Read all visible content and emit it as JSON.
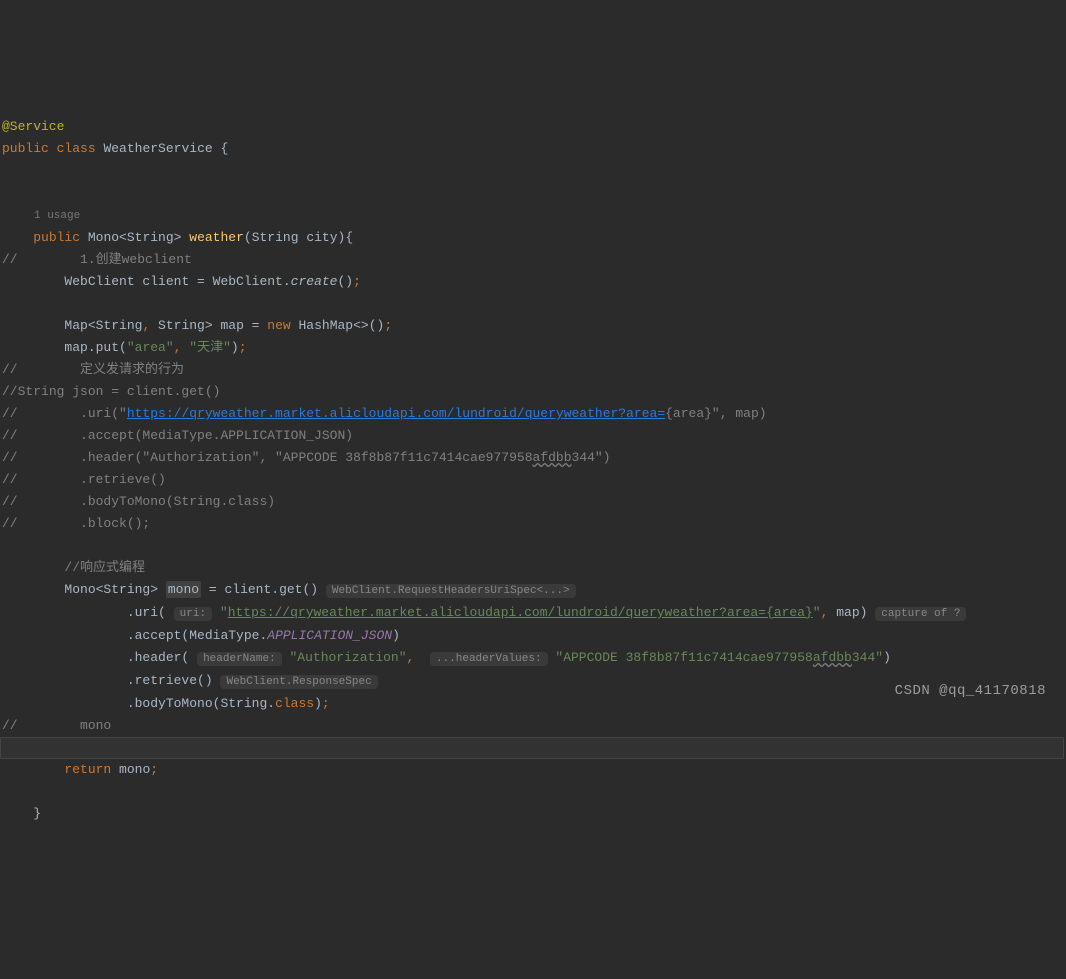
{
  "line1_annotation": "@Service",
  "line2": {
    "kw_public": "public",
    "kw_class": "class",
    "class_name": "WeatherService",
    "brace": "{"
  },
  "usage_hint": "1 usage",
  "line_method": {
    "kw_public": "public",
    "ret_type": "Mono<String>",
    "method_name": "weather",
    "param_type": "String",
    "param_name": "city",
    "tail": "){"
  },
  "line_c1": {
    "prefix": "//",
    "text": "        1.创建webclient"
  },
  "line_create": {
    "text1": "WebClient client = WebClient.",
    "call": "create",
    "text2": "();"
  },
  "line_map": {
    "text1": "Map<String",
    "comma": ",",
    "text2": " String> map = ",
    "kw_new": "new",
    "text3": " HashMap<>()",
    "semi": ";"
  },
  "line_put": {
    "text1": "map.put(",
    "s1": "\"area\"",
    "comma": ",",
    "s2": "\"天津\"",
    "tail": ");"
  },
  "line_cc0": {
    "prefix": "//",
    "text": "        定义发请求的行为"
  },
  "line_cc1": {
    "prefix": "//",
    "text": "String json = client.get()"
  },
  "line_cc2": {
    "prefix": "//",
    "text": "        .uri(\"",
    "url": "https://qryweather.market.alicloudapi.com/lundroid/queryweather?area=",
    "tail": "{area}\", map)"
  },
  "line_cc3": {
    "prefix": "//",
    "text": "        .accept(MediaType.APPLICATION_JSON)"
  },
  "line_cc4": {
    "prefix": "//",
    "text": "        .header(\"Authorization\",",
    "text2": " \"APPCODE 38f8b87f11c7414cae977958",
    "warn": "afdbb",
    "text3": "344\")"
  },
  "line_cc5": {
    "prefix": "//",
    "text": "        .retrieve()"
  },
  "line_cc6": {
    "prefix": "//",
    "text": "        .bodyToMono(String.class)"
  },
  "line_cc7": {
    "prefix": "//",
    "text": "        .block();"
  },
  "line_react_comment": "//响应式编程",
  "line_monodecl": {
    "text1": "Mono<String> ",
    "var": "mono",
    "text2": " = client.get()",
    "inlay": "WebClient.RequestHeadersUriSpec<...>"
  },
  "line_uri": {
    "text1": ".uri(",
    "inlay_label": "uri:",
    "s_open": "\"",
    "url": "https://qryweather.market.alicloudapi.com/lundroid/queryweather?area={area}",
    "s_close": "\"",
    "comma": ",",
    "text2": " map)",
    "inlay2": "capture of ?"
  },
  "line_accept": {
    "text1": ".accept(MediaType.",
    "static_field": "APPLICATION_JSON",
    "text2": ")"
  },
  "line_header": {
    "text1": ".header(",
    "inlay1": "headerName:",
    "s1": "\"Authorization\"",
    "comma": ",",
    "inlay2": "...headerValues:",
    "s2a": "\"APPCODE 38f8b87f11c7414cae977958",
    "warn": "afdbb",
    "s2b": "344\"",
    "tail": ")"
  },
  "line_retrieve": {
    "text1": ".retrieve()",
    "inlay": "WebClient.ResponseSpec"
  },
  "line_bodyto": {
    "text1": ".bodyToMono(String.",
    "kw_class": "class",
    "text2": ");"
  },
  "line_cc_mono": {
    "prefix": "//",
    "text": "        mono"
  },
  "line_return": {
    "kw_return": "return",
    "text": " mono",
    "semi": ";"
  },
  "line_close_method": "}",
  "watermark": "CSDN @qq_41170818"
}
